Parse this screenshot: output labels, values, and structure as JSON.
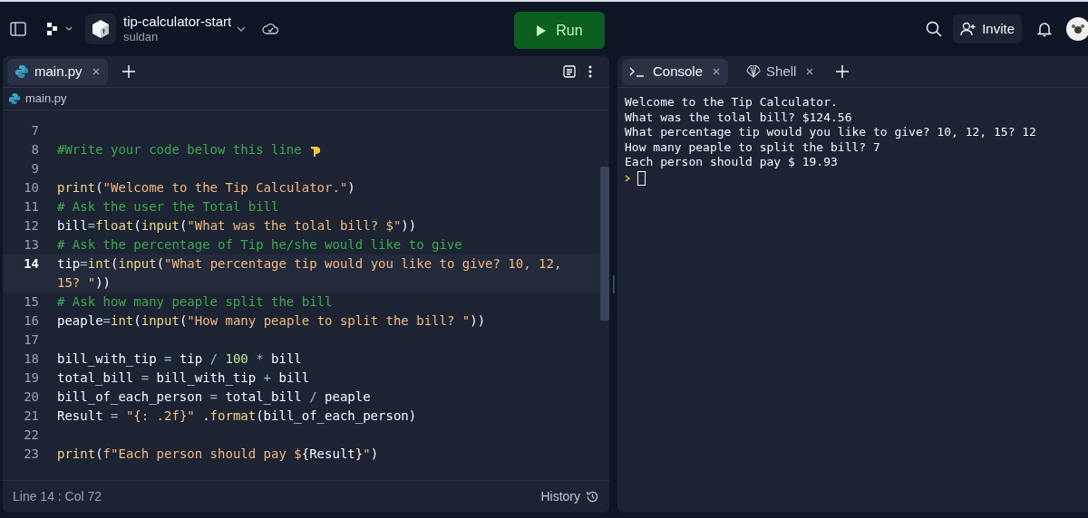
{
  "top_bar": {
    "repl_name": "tip-calculator-start",
    "owner": "suldan",
    "run_button": "Run",
    "invite_button": "Invite"
  },
  "editor": {
    "tabs": [
      {
        "label": "main.py",
        "selected": true
      }
    ],
    "breadcrumb": "main.py",
    "lines": [
      {
        "number": "7",
        "selected": false
      },
      {
        "number": "8",
        "selected": false,
        "tokens": [
          {
            "kind": "com",
            "text": "#Write your code below this line "
          },
          {
            "kind": "hand"
          }
        ]
      },
      {
        "number": "9",
        "selected": false
      },
      {
        "number": "10",
        "selected": false,
        "tokens": [
          {
            "kind": "fn",
            "text": "print"
          },
          {
            "kind": "txt",
            "text": "("
          },
          {
            "kind": "str",
            "text": "\"Welcome to the Tip Calculator.\""
          },
          {
            "kind": "txt",
            "text": ")"
          }
        ]
      },
      {
        "number": "11",
        "selected": false,
        "tokens": [
          {
            "kind": "com",
            "text": "# Ask the user the Total bill"
          }
        ]
      },
      {
        "number": "12",
        "selected": false,
        "tokens": [
          {
            "kind": "txt",
            "text": "bill"
          },
          {
            "kind": "op",
            "text": "="
          },
          {
            "kind": "fn",
            "text": "float"
          },
          {
            "kind": "txt",
            "text": "("
          },
          {
            "kind": "fn",
            "text": "input"
          },
          {
            "kind": "txt",
            "text": "("
          },
          {
            "kind": "str",
            "text": "\"What was the tolal bill? $\""
          },
          {
            "kind": "txt",
            "text": "))"
          }
        ]
      },
      {
        "number": "13",
        "selected": false,
        "tokens": [
          {
            "kind": "com",
            "text": "# Ask the percentage of Tip he/she would like to give"
          }
        ]
      },
      {
        "number": "14",
        "selected": true,
        "tokens": [
          {
            "kind": "txt",
            "text": "tip"
          },
          {
            "kind": "op",
            "text": "="
          },
          {
            "kind": "fn",
            "text": "int"
          },
          {
            "kind": "txt",
            "text": "("
          },
          {
            "kind": "fn",
            "text": "input"
          },
          {
            "kind": "txt",
            "text": "("
          },
          {
            "kind": "str",
            "text": "\"What percentage tip would you like to give? 10, 12, 15? \""
          },
          {
            "kind": "txt",
            "text": "))"
          }
        ]
      },
      {
        "number": "15",
        "selected": false,
        "tokens": [
          {
            "kind": "com",
            "text": "# Ask how many peaple split the bill"
          }
        ]
      },
      {
        "number": "16",
        "selected": false,
        "tokens": [
          {
            "kind": "txt",
            "text": "peaple"
          },
          {
            "kind": "op",
            "text": "="
          },
          {
            "kind": "fn",
            "text": "int"
          },
          {
            "kind": "txt",
            "text": "("
          },
          {
            "kind": "fn",
            "text": "input"
          },
          {
            "kind": "txt",
            "text": "("
          },
          {
            "kind": "str",
            "text": "\"How many peaple to split the bill? \""
          },
          {
            "kind": "txt",
            "text": "))"
          }
        ]
      },
      {
        "number": "17",
        "selected": false
      },
      {
        "number": "18",
        "selected": false,
        "tokens": [
          {
            "kind": "txt",
            "text": "bill_with_tip "
          },
          {
            "kind": "op",
            "text": "="
          },
          {
            "kind": "txt",
            "text": " tip "
          },
          {
            "kind": "op",
            "text": "/ "
          },
          {
            "kind": "num",
            "text": "100"
          },
          {
            "kind": "op",
            "text": " * "
          },
          {
            "kind": "txt",
            "text": "bill"
          }
        ]
      },
      {
        "number": "19",
        "selected": false,
        "tokens": [
          {
            "kind": "txt",
            "text": "total_bill "
          },
          {
            "kind": "op",
            "text": "="
          },
          {
            "kind": "txt",
            "text": " bill_with_tip "
          },
          {
            "kind": "op",
            "text": "+"
          },
          {
            "kind": "txt",
            "text": " bill"
          }
        ]
      },
      {
        "number": "20",
        "selected": false,
        "tokens": [
          {
            "kind": "txt",
            "text": "bill_of_each_person "
          },
          {
            "kind": "op",
            "text": "="
          },
          {
            "kind": "txt",
            "text": " total_bill "
          },
          {
            "kind": "op",
            "text": "/"
          },
          {
            "kind": "txt",
            "text": " peaple"
          }
        ]
      },
      {
        "number": "21",
        "selected": false,
        "tokens": [
          {
            "kind": "txt",
            "text": "Result "
          },
          {
            "kind": "op",
            "text": "= "
          },
          {
            "kind": "str",
            "text": "\"{: .2f}\""
          },
          {
            "kind": "txt",
            "text": " ."
          },
          {
            "kind": "fn",
            "text": "format"
          },
          {
            "kind": "txt",
            "text": "(bill_of_each_person)"
          }
        ]
      },
      {
        "number": "22",
        "selected": false
      },
      {
        "number": "23",
        "selected": false,
        "tokens": [
          {
            "kind": "fn",
            "text": "print"
          },
          {
            "kind": "txt",
            "text": "("
          },
          {
            "kind": "str",
            "text": "f\"Each person should pay $"
          },
          {
            "kind": "txt",
            "text": "{Result}"
          },
          {
            "kind": "str",
            "text": "\""
          },
          {
            "kind": "txt",
            "text": ")"
          }
        ]
      }
    ],
    "status": "Line 14 : Col 72",
    "history": "History"
  },
  "console": {
    "tabs": [
      {
        "label": "Console",
        "kind": "console",
        "selected": true
      },
      {
        "label": "Shell",
        "kind": "shell",
        "selected": false
      }
    ],
    "output": [
      "Welcome to the Tip Calculator.",
      "What was the tolal bill? $124.56",
      "What percentage tip would you like to give? 10, 12, 15? 12",
      "How many peaple to split the bill? 7",
      "Each person should pay $ 19.93"
    ]
  }
}
